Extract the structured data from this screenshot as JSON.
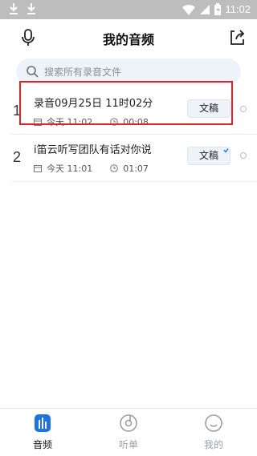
{
  "status_bar": {
    "time": "11:02"
  },
  "header": {
    "title": "我的音频",
    "mic_icon": "mic-icon",
    "export_icon": "export-icon"
  },
  "search": {
    "placeholder": "搜索所有录音文件"
  },
  "recordings": [
    {
      "index": "1",
      "name": "录音09月25日 11时02分",
      "date": "今天 11:02",
      "duration": "00:08",
      "action": "文稿"
    },
    {
      "index": "2",
      "name": "i笛云听写团队有话对你说",
      "date": "今天 11:01",
      "duration": "01:07",
      "action": "文稿"
    }
  ],
  "nav": {
    "items": [
      {
        "label": "音频",
        "icon": "audio-bars-icon",
        "active": true
      },
      {
        "label": "听单",
        "icon": "disc-icon",
        "active": false
      },
      {
        "label": "我的",
        "icon": "smile-icon",
        "active": false
      }
    ]
  },
  "colors": {
    "accent": "#1a73e8",
    "highlight": "#d9252b",
    "status_bar": "#bdbdbd"
  }
}
